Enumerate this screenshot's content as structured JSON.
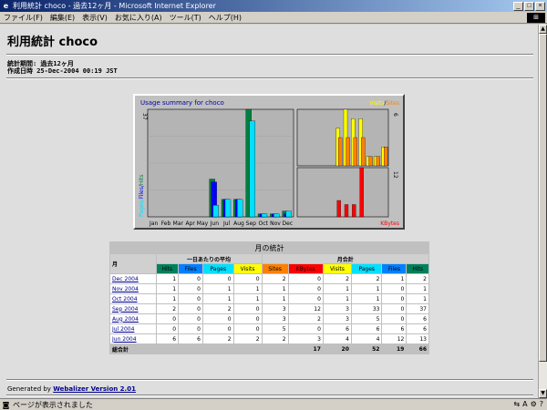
{
  "window": {
    "title": "利用統計 choco - 過去12ヶ月 - Microsoft Internet Explorer",
    "minimize": "_",
    "maximize": "□",
    "close": "×"
  },
  "menu": [
    "ファイル(F)",
    "編集(E)",
    "表示(V)",
    "お気に入り(A)",
    "ツール(T)",
    "ヘルプ(H)"
  ],
  "report": {
    "title": "利用統計 choco",
    "period": "統計期間: 過去12ヶ月",
    "generated": "作成日時 25-Dec-2004 00:19 JST"
  },
  "chart_data": {
    "type": "bar",
    "title": "Usage summary for choco",
    "legend_right": [
      "Visits",
      "Sites"
    ],
    "y_left_label": [
      "Pages",
      "Files",
      "Hits"
    ],
    "y_left_max": 37,
    "y_right_top_max": 6,
    "y_right_bottom_max": 12,
    "bottom_right_label": "KBytes",
    "categories": [
      "Jan",
      "Feb",
      "Mar",
      "Apr",
      "May",
      "Jun",
      "Jul",
      "Aug",
      "Sep",
      "Oct",
      "Nov",
      "Dec"
    ],
    "series": [
      {
        "name": "Hits",
        "values": [
          0,
          0,
          0,
          0,
          0,
          13,
          6,
          6,
          37,
          1,
          1,
          2
        ]
      },
      {
        "name": "Files",
        "values": [
          0,
          0,
          0,
          0,
          0,
          12,
          6,
          6,
          0,
          1,
          1,
          1
        ]
      },
      {
        "name": "Pages",
        "values": [
          0,
          0,
          0,
          0,
          0,
          4,
          6,
          6,
          33,
          1,
          1,
          2
        ]
      },
      {
        "name": "Visits",
        "values": [
          0,
          0,
          0,
          0,
          0,
          4,
          6,
          5,
          5,
          1,
          1,
          2
        ]
      },
      {
        "name": "Sites",
        "values": [
          0,
          0,
          0,
          0,
          0,
          3,
          3,
          3,
          3,
          1,
          1,
          2
        ]
      },
      {
        "name": "KBytes",
        "values": [
          0,
          0,
          0,
          0,
          0,
          4,
          3,
          3,
          12,
          0,
          0,
          0
        ]
      }
    ],
    "colors": {
      "Hits": "#008040",
      "Files": "#0000ff",
      "Pages": "#00e0ff",
      "Visits": "#ffff00",
      "Sites": "#ff8000",
      "KBytes": "#ff0000"
    }
  },
  "stats": {
    "caption": "月の統計",
    "month_header": "月",
    "group_daily": "一日あたりの平均",
    "group_monthly": "月合計",
    "columns": [
      {
        "label": "Hits",
        "color": "#00805c",
        "text": "#000"
      },
      {
        "label": "Files",
        "color": "#0080ff",
        "text": "#000"
      },
      {
        "label": "Pages",
        "color": "#00e0ff",
        "text": "#000"
      },
      {
        "label": "Visits",
        "color": "#ffff00",
        "text": "#000"
      },
      {
        "label": "Sites",
        "color": "#ff8000",
        "text": "#000"
      },
      {
        "label": "KBytes",
        "color": "#ff0000",
        "text": "#000"
      },
      {
        "label": "Visits",
        "color": "#ffff00",
        "text": "#000"
      },
      {
        "label": "Pages",
        "color": "#00e0ff",
        "text": "#000"
      },
      {
        "label": "Files",
        "color": "#0080ff",
        "text": "#000"
      },
      {
        "label": "Hits",
        "color": "#00805c",
        "text": "#000"
      }
    ],
    "rows": [
      {
        "month": "Dec 2004",
        "values": [
          "1",
          "0",
          "0",
          "0",
          "2",
          "0",
          "2",
          "2",
          "1",
          "2"
        ]
      },
      {
        "month": "Nov 2004",
        "values": [
          "1",
          "0",
          "1",
          "1",
          "1",
          "0",
          "1",
          "1",
          "0",
          "1"
        ]
      },
      {
        "month": "Oct 2004",
        "values": [
          "1",
          "0",
          "1",
          "1",
          "1",
          "0",
          "1",
          "1",
          "0",
          "1"
        ]
      },
      {
        "month": "Sep 2004",
        "values": [
          "2",
          "0",
          "2",
          "0",
          "3",
          "12",
          "3",
          "33",
          "0",
          "37"
        ]
      },
      {
        "month": "Aug 2004",
        "values": [
          "0",
          "0",
          "0",
          "0",
          "3",
          "2",
          "3",
          "5",
          "0",
          "6"
        ]
      },
      {
        "month": "Jul 2004",
        "values": [
          "0",
          "0",
          "0",
          "0",
          "5",
          "0",
          "6",
          "6",
          "6",
          "6"
        ]
      },
      {
        "month": "Jun 2004",
        "values": [
          "6",
          "6",
          "2",
          "2",
          "2",
          "3",
          "4",
          "4",
          "12",
          "13"
        ]
      }
    ],
    "total_label": "総合計",
    "totals": [
      "17",
      "20",
      "52",
      "19",
      "66"
    ]
  },
  "footer": {
    "prefix": "Generated by ",
    "link": "Webalizer Version 2.01"
  },
  "status": {
    "text": "ページが表示されました"
  }
}
